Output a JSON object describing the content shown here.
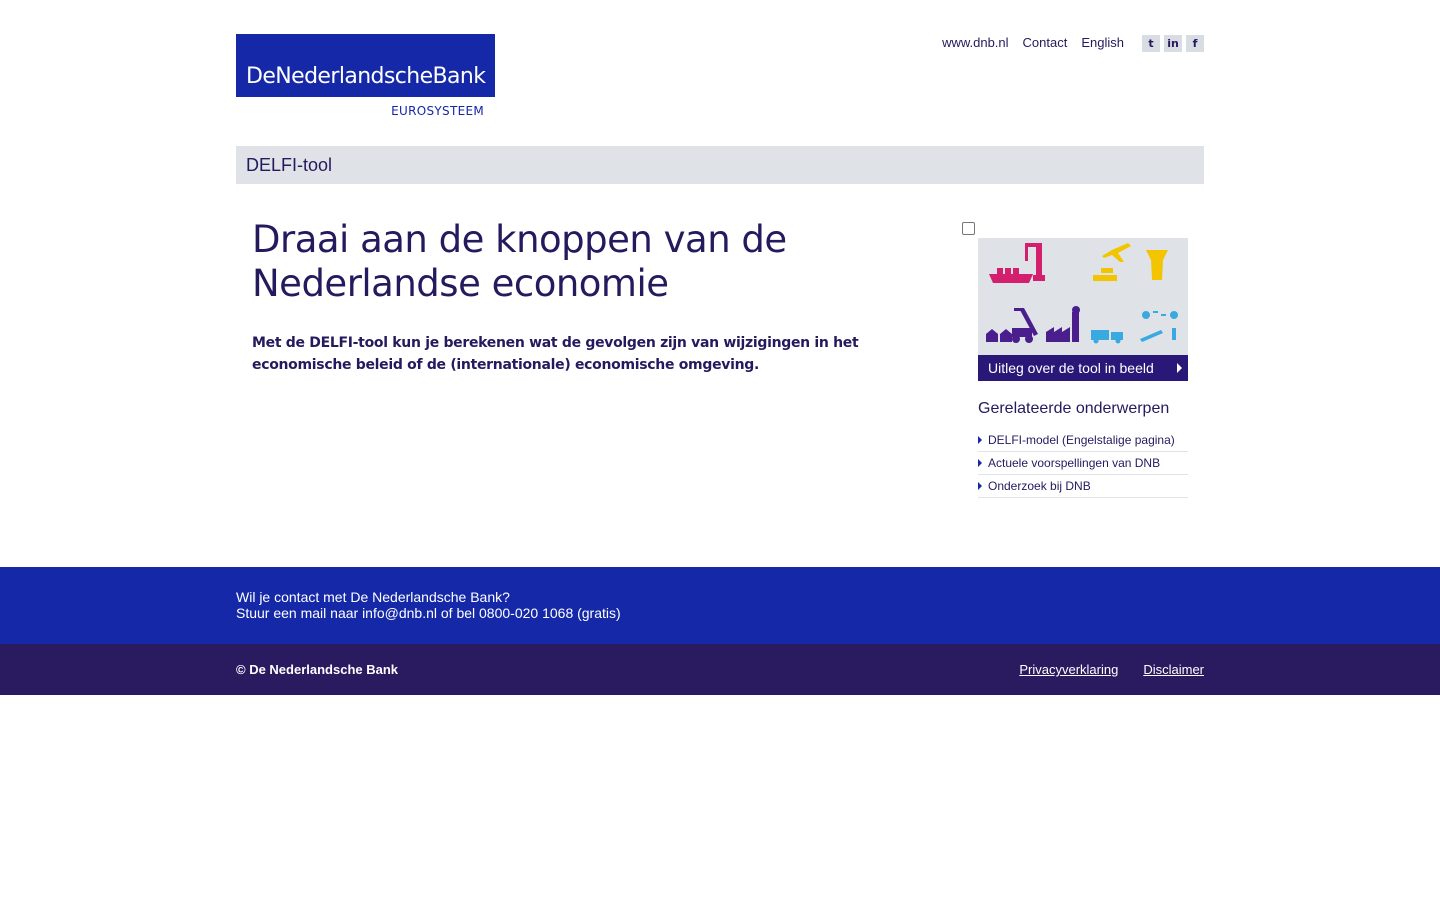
{
  "header": {
    "logo_name": "DeNederlandscheBank",
    "logo_sub": "EUROSYSTEEM",
    "links": [
      "www.dnb.nl",
      "Contact",
      "English"
    ],
    "social": [
      "twitter-icon",
      "linkedin-icon",
      "facebook-icon"
    ],
    "social_glyphs": [
      "t",
      "in",
      "f"
    ]
  },
  "titlebar": {
    "title": "DELFI-tool"
  },
  "main": {
    "headline": "Draai aan de knoppen van de Nederlandse economie",
    "intro": "Met de DELFI-tool kun je berekenen wat de gevolgen zijn van wijzigingen in het economische beleid of de (internationale) economische omgeving."
  },
  "sidebar": {
    "card_caption": "Uitleg over de tool in beeld",
    "related_title": "Gerelateerde onderwerpen",
    "related": [
      "DELFI-model (Engelstalige pagina)",
      "Actuele voorspellingen van DNB",
      "Onderzoek bij DNB"
    ],
    "illustration_colors": {
      "pink": "#d41f6e",
      "yellow": "#f2c500",
      "purple": "#4a1e8c",
      "blue": "#39a9e0"
    }
  },
  "footer": {
    "contact_line1": "Wil je contact met De Nederlandsche Bank?",
    "contact_line2": "Stuur een mail naar info@dnb.nl of bel 0800-020 1068 (gratis)",
    "copyright": "© De Nederlandsche Bank",
    "links": [
      "Privacyverklaring",
      "Disclaimer"
    ]
  }
}
